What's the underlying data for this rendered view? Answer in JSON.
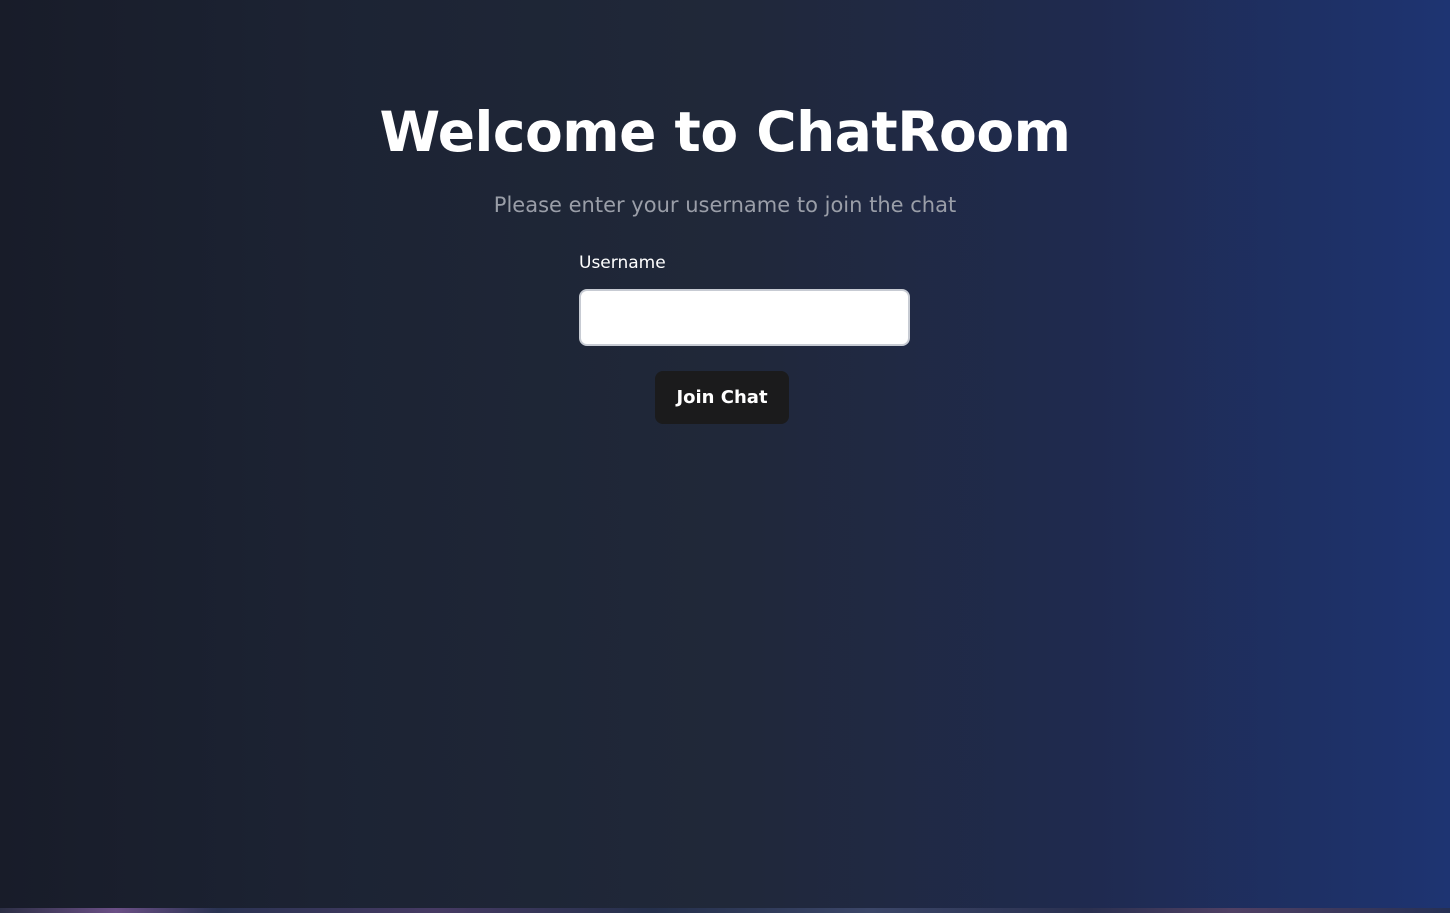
{
  "header": {
    "title": "Welcome to ChatRoom",
    "subtitle": "Please enter your username to join the chat"
  },
  "form": {
    "username_label": "Username",
    "username_value": "",
    "username_placeholder": "",
    "join_button_label": "Join Chat"
  },
  "colors": {
    "background_left": "#181c29",
    "background_right": "#1e3472",
    "button_background": "#1b1b1c",
    "text_primary": "#ffffff",
    "text_muted": "#9a9ea8"
  }
}
